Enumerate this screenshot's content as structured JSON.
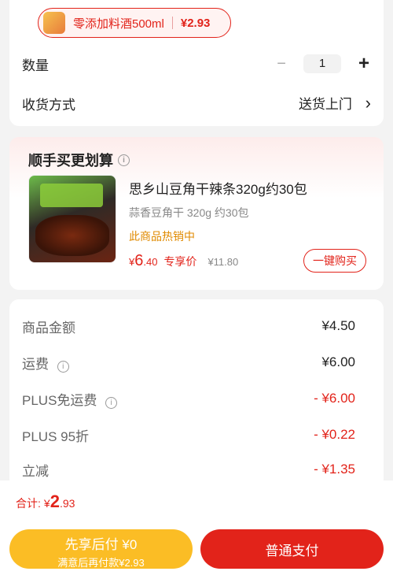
{
  "selected_item": {
    "name": "零添加料酒500ml",
    "price": "¥2.93"
  },
  "quantity": {
    "label": "数量",
    "minus": "−",
    "value": "1",
    "plus": "+"
  },
  "delivery": {
    "label": "收货方式",
    "value": "送货上门",
    "chevron": "›"
  },
  "upsell": {
    "title": "顺手买更划算",
    "info_icon": "i",
    "product": {
      "name": "思乡山豆角干辣条320g约30包",
      "spec": "蒜香豆角干 320g 约30包",
      "tag": "此商品热销中",
      "price_symbol": "¥",
      "price_int": "6",
      "price_dec": ".40",
      "price_label": "专享价",
      "orig_price": "¥11.80",
      "buy_label": "一键购买"
    }
  },
  "summary": {
    "rows": [
      {
        "label": "商品金额",
        "value": "¥4.50"
      },
      {
        "label": "运费",
        "value": "¥6.00"
      },
      {
        "label": "PLUS免运费",
        "value": "- ¥6.00"
      },
      {
        "label": "PLUS 95折",
        "value": "- ¥0.22"
      },
      {
        "label": "立减",
        "value": "- ¥1.35"
      }
    ]
  },
  "footer": {
    "total_label": "合计:",
    "total_symbol": "¥",
    "total_int": "2",
    "total_dec": ".93",
    "pay_later_title": "先享后付 ¥0",
    "pay_later_sub": "满意后再付款¥2.93",
    "normal_pay": "普通支付"
  },
  "colors": {
    "accent": "#e2231a",
    "pay_later": "#fbbd25",
    "tag_orange": "#e08a00"
  }
}
